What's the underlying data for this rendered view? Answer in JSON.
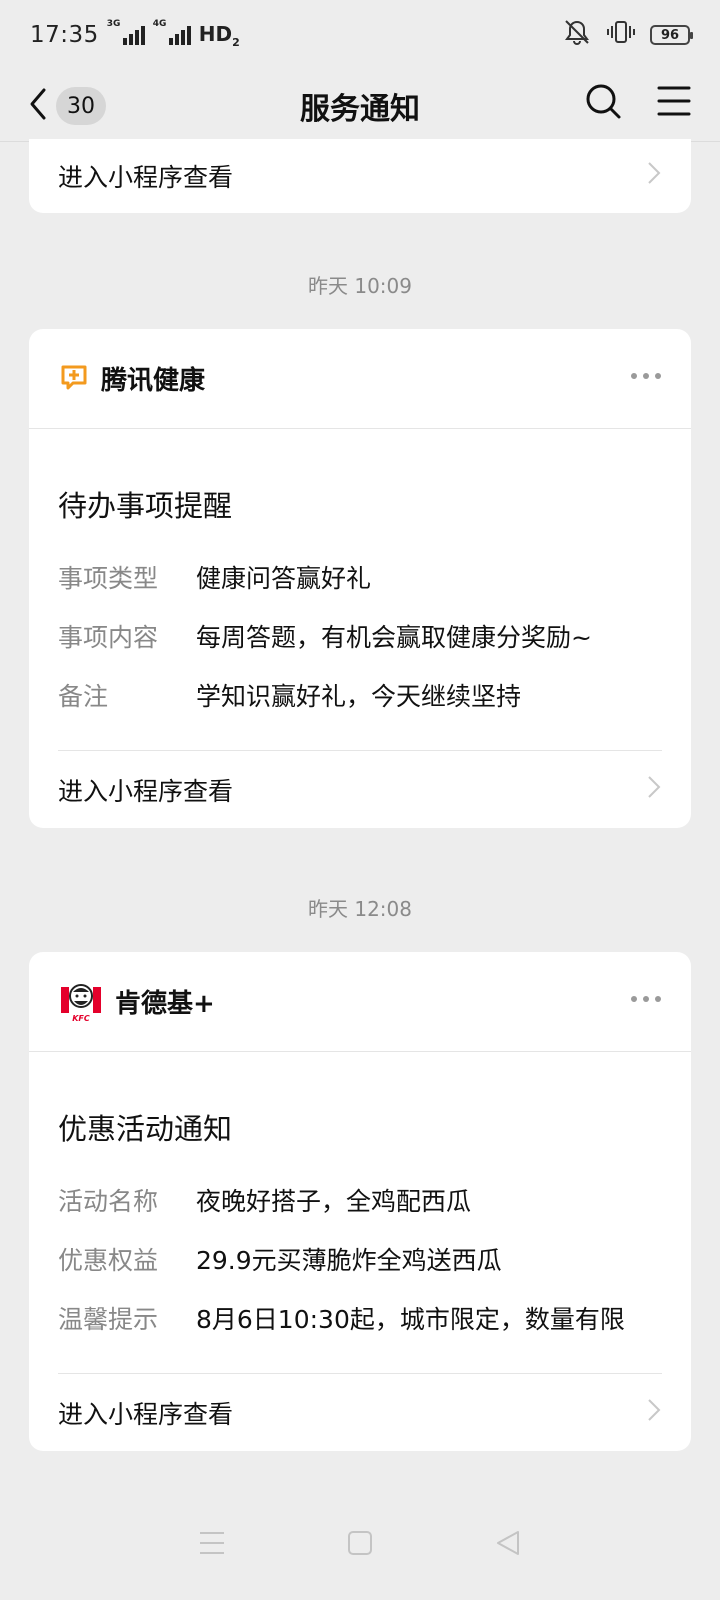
{
  "status_bar": {
    "time": "17:35",
    "signal1_label": "3G",
    "signal2_label": "4G",
    "hd": "HD",
    "hd_sub": "2",
    "battery": "96"
  },
  "nav": {
    "unread_count": "30",
    "title": "服务通知"
  },
  "top_card": {
    "link_label": "进入小程序查看"
  },
  "messages": [
    {
      "timestamp": "昨天 10:09",
      "app_name": "腾讯健康",
      "title": "待办事项提醒",
      "rows": [
        {
          "label": "事项类型",
          "value": "健康问答赢好礼"
        },
        {
          "label": "事项内容",
          "value": "每周答题，有机会赢取健康分奖励~"
        },
        {
          "label": "备注",
          "value": "学知识赢好礼，今天继续坚持"
        }
      ],
      "link_label": "进入小程序查看"
    },
    {
      "timestamp": "昨天 12:08",
      "app_name": "肯德基+",
      "logo_text": "KFC",
      "title": "优惠活动通知",
      "rows": [
        {
          "label": "活动名称",
          "value": "夜晚好搭子，全鸡配西瓜"
        },
        {
          "label": "优惠权益",
          "value": "29.9元买薄脆炸全鸡送西瓜"
        },
        {
          "label": "温馨提示",
          "value": "8月6日10:30起，城市限定，数量有限"
        }
      ],
      "link_label": "进入小程序查看"
    }
  ],
  "colors": {
    "background": "#ededed",
    "card": "#ffffff",
    "health_accent": "#f39a1e",
    "kfc_red": "#e4002b",
    "label_gray": "#888888"
  }
}
